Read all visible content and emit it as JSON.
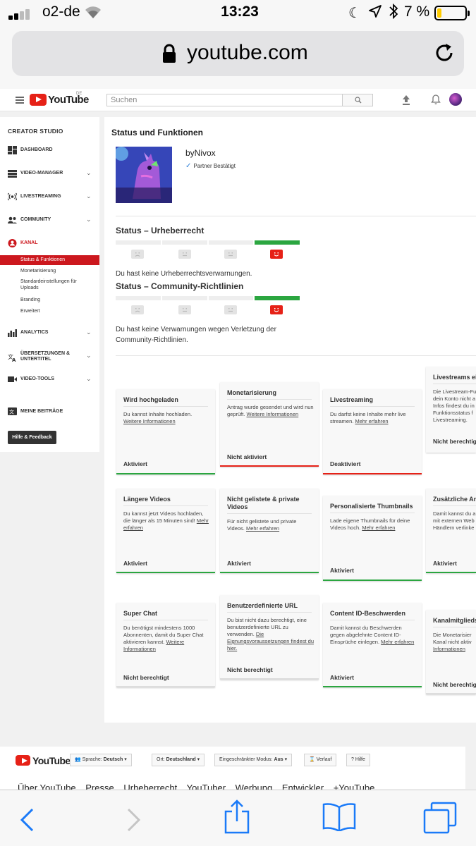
{
  "ios_status": {
    "carrier": "o2-de",
    "time": "13:23",
    "battery_pct": "7 %",
    "battery_level": 0.07
  },
  "url_bar": {
    "domain": "youtube.com"
  },
  "yt_header": {
    "logo_text": "YouTube",
    "logo_region": "DE",
    "search_placeholder": "Suchen"
  },
  "sidebar": {
    "title": "CREATOR STUDIO",
    "items": [
      {
        "label": "DASHBOARD",
        "icon": "dashboard-icon"
      },
      {
        "label": "VIDEO-MANAGER",
        "icon": "video-manager-icon"
      },
      {
        "label": "LIVESTREAMING",
        "icon": "livestream-icon"
      },
      {
        "label": "COMMUNITY",
        "icon": "community-icon"
      },
      {
        "label": "KANAL",
        "icon": "channel-icon"
      },
      {
        "label": "ANALYTICS",
        "icon": "analytics-icon"
      },
      {
        "label": "ÜBERSETZUNGEN &",
        "label2": "UNTERTITEL",
        "icon": "translate-icon"
      },
      {
        "label": "VIDEO-TOOLS",
        "icon": "video-tools-icon"
      },
      {
        "label": "MEINE BEITRÄGE",
        "icon": "contributions-icon"
      }
    ],
    "kanal_subitems": [
      "Status & Funktionen",
      "Monetarisierung",
      "Standardeinstellungen für",
      "Uploads",
      "Branding",
      "Erweitert"
    ],
    "help_button": "Hilfe & Feedback"
  },
  "main": {
    "title": "Status und Funktionen",
    "channel_name": "byNivox",
    "partner_status": "Partner Bestätigt",
    "copyright": {
      "title": "Status – Urheberrecht",
      "text": "Du hast keine Urheberrechtsverwarnungen."
    },
    "community": {
      "title": "Status – Community-Richtlinien",
      "text1": "Du hast keine Verwarnungen wegen Verletzung der",
      "text2": "Community-Richtlinien."
    },
    "cards": [
      {
        "title": "Wird hochgeladen",
        "desc": "Du kannst Inhalte hochladen.",
        "link": "Weitere Informationen",
        "status": "Aktiviert",
        "bar": "green"
      },
      {
        "title": "Monetarisierung",
        "desc": "Antrag wurde gesendet und wird nun geprüft.",
        "link": "Weitere Informationen",
        "status": "Nicht aktiviert",
        "bar": "red"
      },
      {
        "title": "Livestreaming",
        "desc": "Du darfst keine Inhalte mehr live streamen.",
        "link": "Mehr erfahren",
        "status": "Deaktiviert",
        "bar": "red"
      },
      {
        "title": "Livestreams ei",
        "desc": "Die Livestream-Fu dein Konto nicht a Infos findest du in Funktionsstatus f Livestreaming.",
        "link": "",
        "status": "Nicht berechtigt",
        "bar": "grey"
      },
      {
        "title": "Längere Videos",
        "desc": "Du kannst jetzt Videos hochladen, die länger als 15 Minuten sind!",
        "link": "Mehr erfahren",
        "status": "Aktiviert",
        "bar": "green"
      },
      {
        "title": "Nicht gelistete & private Videos",
        "desc": "Für nicht gelistete und private Videos.",
        "link": "Mehr erfahren",
        "status": "Aktiviert",
        "bar": "green"
      },
      {
        "title": "Personalisierte Thumbnails",
        "desc": "Lade eigene Thumbnails für deine Videos hoch.",
        "link": "Mehr erfahren",
        "status": "Aktiviert",
        "bar": "green"
      },
      {
        "title": "Zusätzliche An",
        "desc": "Damit kannst du a mit externen Web Händlern verlinke",
        "link": "",
        "status": "Aktiviert",
        "bar": "green"
      },
      {
        "title": "Super Chat",
        "desc": "Du benötigst mindestens 1000 Abonnenten, damit du Super Chat aktivieren kannst.",
        "link": "Weitere Informationen",
        "status": "Nicht berechtigt",
        "bar": "grey"
      },
      {
        "title": "Benutzerdefinierte URL",
        "desc": "Du bist nicht dazu berechtigt, eine benutzerdefinierte URL zu verwenden.",
        "link": "Die Eignungsvoraussetzungen findest du hier.",
        "status": "Nicht berechtigt",
        "bar": "grey"
      },
      {
        "title": "Content ID-Beschwerden",
        "desc": "Damit kannst du Beschwerden gegen abgelehnte Content ID-Einsprüche einlegen.",
        "link": "Mehr erfahren",
        "status": "Aktiviert",
        "bar": "green"
      },
      {
        "title": "Kanalmitglieds",
        "desc": "Die Monetarisier Kanal nicht aktiv",
        "link": "Informationen",
        "status": "Nicht berechtig",
        "bar": "grey"
      }
    ]
  },
  "footer": {
    "logo_text": "YouTube",
    "lang_label": "Sprache:",
    "lang_value": "Deutsch",
    "loc_label": "Ort:",
    "loc_value": "Deutschland",
    "restricted_label": "Eingeschränkter Modus:",
    "restricted_value": "Aus",
    "history": "Verlauf",
    "help": "Hilfe",
    "links": [
      "Über YouTube",
      "Presse",
      "Urheberrecht",
      "YouTuber",
      "Werbung",
      "Entwickler",
      "+YouTube"
    ]
  },
  "colors": {
    "yt_red": "#e62117",
    "active_red": "#cc181e",
    "status_green": "#2ba640",
    "ios_blue": "#1a7af8"
  }
}
